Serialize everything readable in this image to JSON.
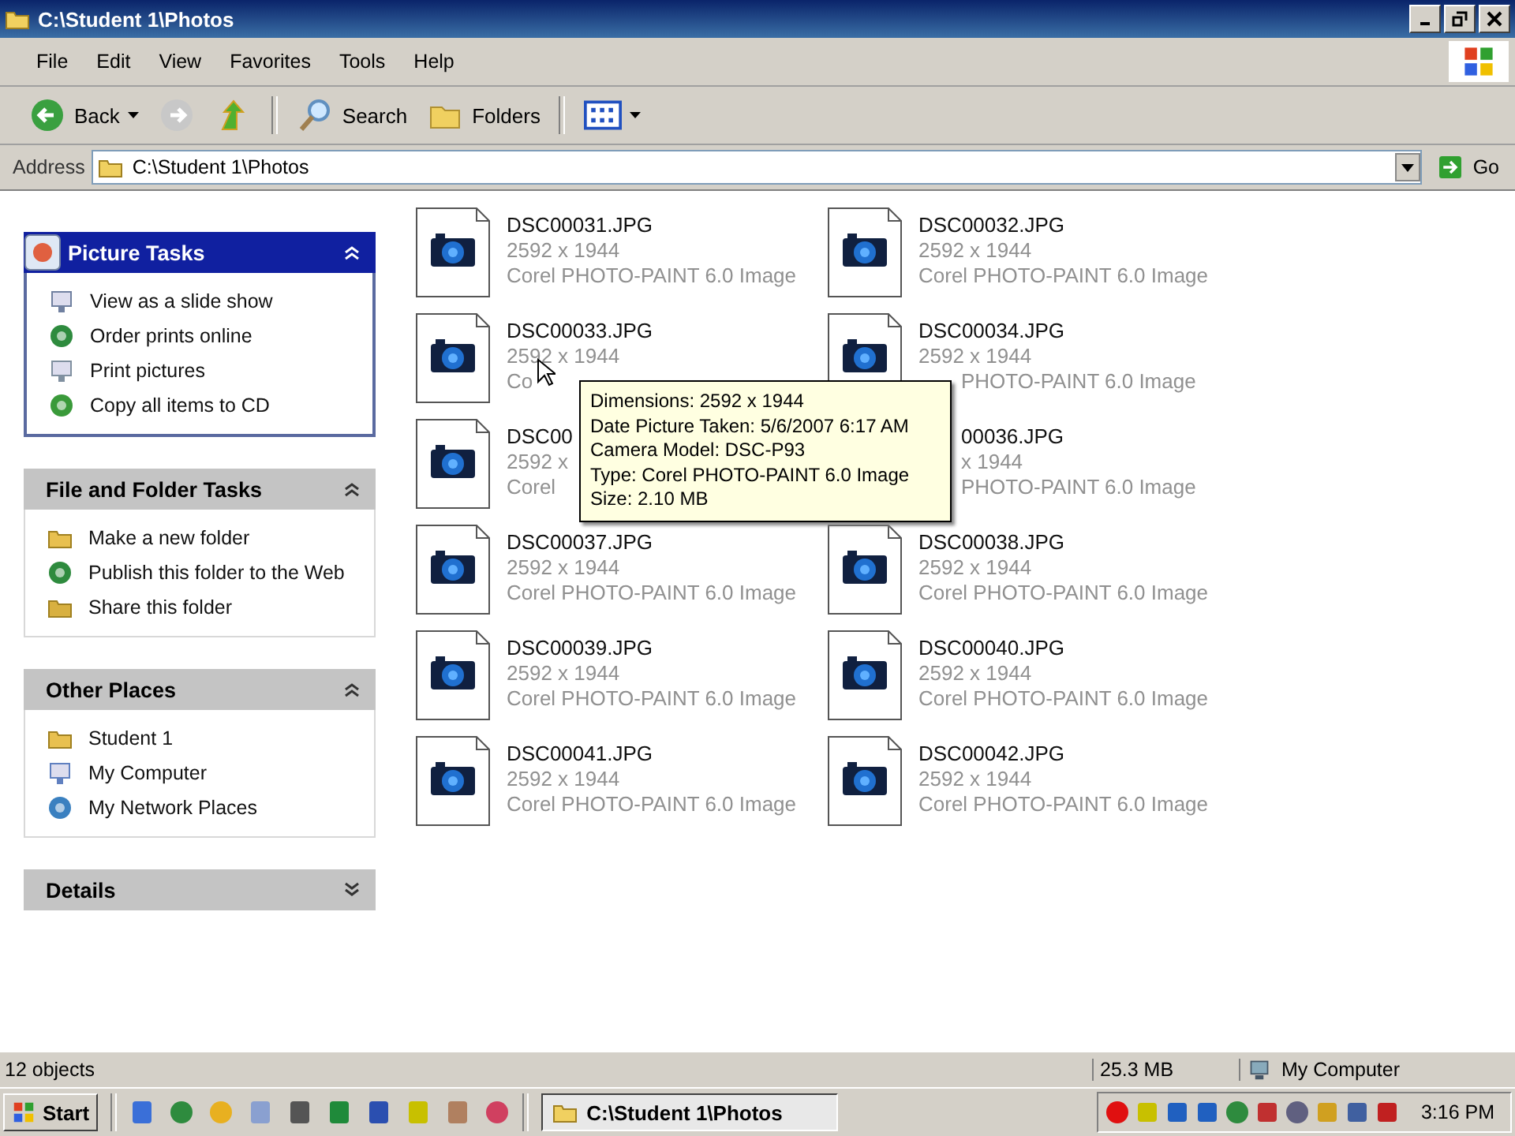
{
  "window": {
    "title": "C:\\Student 1\\Photos"
  },
  "menu": [
    "File",
    "Edit",
    "View",
    "Favorites",
    "Tools",
    "Help"
  ],
  "toolbar": [
    {
      "kind": "back",
      "label": "Back"
    },
    {
      "kind": "forward"
    },
    {
      "kind": "up"
    },
    {
      "kind": "search",
      "label": "Search"
    },
    {
      "kind": "folders",
      "label": "Folders"
    },
    {
      "kind": "views"
    }
  ],
  "address": {
    "label": "Address",
    "value": "C:\\Student 1\\Photos",
    "go": "Go"
  },
  "panels": [
    {
      "title": "Picture Tasks",
      "kind": "special",
      "expanded": true,
      "items": [
        {
          "kind": "slideshow",
          "label": "View as a slide show"
        },
        {
          "kind": "globe",
          "label": "Order prints online"
        },
        {
          "kind": "printer",
          "label": "Print pictures"
        },
        {
          "kind": "cd",
          "label": "Copy all items to CD"
        }
      ]
    },
    {
      "title": "File and Folder Tasks",
      "kind": "plain",
      "expanded": true,
      "items": [
        {
          "kind": "folder",
          "label": "Make a new folder"
        },
        {
          "kind": "globe",
          "label": "Publish this folder to the Web"
        },
        {
          "kind": "share",
          "label": "Share this folder"
        }
      ]
    },
    {
      "title": "Other Places",
      "kind": "plain",
      "expanded": true,
      "items": [
        {
          "kind": "folder",
          "label": "Student 1"
        },
        {
          "kind": "computer",
          "label": "My Computer"
        },
        {
          "kind": "network",
          "label": "My Network Places"
        }
      ]
    },
    {
      "title": "Details",
      "kind": "plain",
      "expanded": false
    }
  ],
  "files": [
    {
      "lines": [
        {
          "kind": "name",
          "text": "DSC00031.JPG",
          "tail": false
        },
        {
          "kind": "info",
          "text": "2592 x 1944",
          "tail": false
        },
        {
          "kind": "info",
          "text": "Corel PHOTO-PAINT 6.0 Image",
          "tail": false
        }
      ]
    },
    {
      "lines": [
        {
          "kind": "name",
          "text": "DSC00032.JPG",
          "tail": false
        },
        {
          "kind": "info",
          "text": "2592 x 1944",
          "tail": false
        },
        {
          "kind": "info",
          "text": "Corel PHOTO-PAINT 6.0 Image",
          "tail": false
        }
      ]
    },
    {
      "lines": [
        {
          "kind": "name",
          "text": "DSC00033.JPG",
          "tail": false
        },
        {
          "kind": "info",
          "text": "2592 x 1944",
          "tail": false
        },
        {
          "kind": "info",
          "text": "Co",
          "tail": false
        }
      ]
    },
    {
      "lines": [
        {
          "kind": "name",
          "text": "DSC00034.JPG",
          "tail": false
        },
        {
          "kind": "info",
          "text": "2592 x 1944",
          "tail": false
        },
        {
          "kind": "info",
          "text": "PHOTO-PAINT 6.0 Image",
          "tail": true
        }
      ]
    },
    {
      "lines": [
        {
          "kind": "name",
          "text": "DSC00",
          "tail": false
        },
        {
          "kind": "info",
          "text": "2592 x",
          "tail": false
        },
        {
          "kind": "info",
          "text": "Corel",
          "tail": false
        }
      ]
    },
    {
      "thumbnail": false,
      "lines": [
        {
          "kind": "name",
          "text": "00036.JPG",
          "tail": true
        },
        {
          "kind": "info",
          "text": "x 1944",
          "tail": true
        },
        {
          "kind": "info",
          "text": "PHOTO-PAINT 6.0 Image",
          "tail": true
        }
      ]
    },
    {
      "lines": [
        {
          "kind": "name",
          "text": "DSC00037.JPG",
          "tail": false
        },
        {
          "kind": "info",
          "text": "2592 x 1944",
          "tail": false
        },
        {
          "kind": "info",
          "text": "Corel PHOTO-PAINT 6.0 Image",
          "tail": false
        }
      ]
    },
    {
      "lines": [
        {
          "kind": "name",
          "text": "DSC00038.JPG",
          "tail": false
        },
        {
          "kind": "info",
          "text": "2592 x 1944",
          "tail": false
        },
        {
          "kind": "info",
          "text": "Corel PHOTO-PAINT 6.0 Image",
          "tail": false
        }
      ]
    },
    {
      "lines": [
        {
          "kind": "name",
          "text": "DSC00039.JPG",
          "tail": false
        },
        {
          "kind": "info",
          "text": "2592 x 1944",
          "tail": false
        },
        {
          "kind": "info",
          "text": "Corel PHOTO-PAINT 6.0 Image",
          "tail": false
        }
      ]
    },
    {
      "lines": [
        {
          "kind": "name",
          "text": "DSC00040.JPG",
          "tail": false
        },
        {
          "kind": "info",
          "text": "2592 x 1944",
          "tail": false
        },
        {
          "kind": "info",
          "text": "Corel PHOTO-PAINT 6.0 Image",
          "tail": false
        }
      ]
    },
    {
      "lines": [
        {
          "kind": "name",
          "text": "DSC00041.JPG",
          "tail": false
        },
        {
          "kind": "info",
          "text": "2592 x 1944",
          "tail": false
        },
        {
          "kind": "info",
          "text": "Corel PHOTO-PAINT 6.0 Image",
          "tail": false
        }
      ]
    },
    {
      "lines": [
        {
          "kind": "name",
          "text": "DSC00042.JPG",
          "tail": false
        },
        {
          "kind": "info",
          "text": "2592 x 1944",
          "tail": false
        },
        {
          "kind": "info",
          "text": "Corel PHOTO-PAINT 6.0 Image",
          "tail": false
        }
      ]
    }
  ],
  "tooltip": {
    "lines": [
      "Dimensions: 2592 x 1944",
      "Date Picture Taken: 5/6/2007 6:17 AM",
      "Camera Model: DSC-P93",
      "Type: Corel PHOTO-PAINT 6.0 Image",
      "Size: 2.10 MB"
    ]
  },
  "status_bar": {
    "objects": "12 objects",
    "size": "25.3 MB",
    "zone": "My Computer"
  },
  "taskbar": {
    "start": "Start",
    "quick_launch": [
      {
        "kind": "browser"
      },
      {
        "kind": "globe"
      },
      {
        "kind": "media"
      },
      {
        "kind": "document"
      },
      {
        "kind": "arrows"
      },
      {
        "kind": "sheet"
      },
      {
        "kind": "writer"
      },
      {
        "kind": "letter"
      },
      {
        "kind": "pen"
      },
      {
        "kind": "flower"
      }
    ],
    "tasks": [
      {
        "label": "C:\\Student 1\\Photos",
        "selected": true
      }
    ],
    "tray": [
      {
        "kind": "record"
      },
      {
        "kind": "letter"
      },
      {
        "kind": "network"
      },
      {
        "kind": "network"
      },
      {
        "kind": "globe"
      },
      {
        "kind": "speaker"
      },
      {
        "kind": "gear"
      },
      {
        "kind": "key"
      },
      {
        "kind": "monitor"
      },
      {
        "kind": "shield"
      }
    ],
    "clock": "3:16 PM"
  }
}
